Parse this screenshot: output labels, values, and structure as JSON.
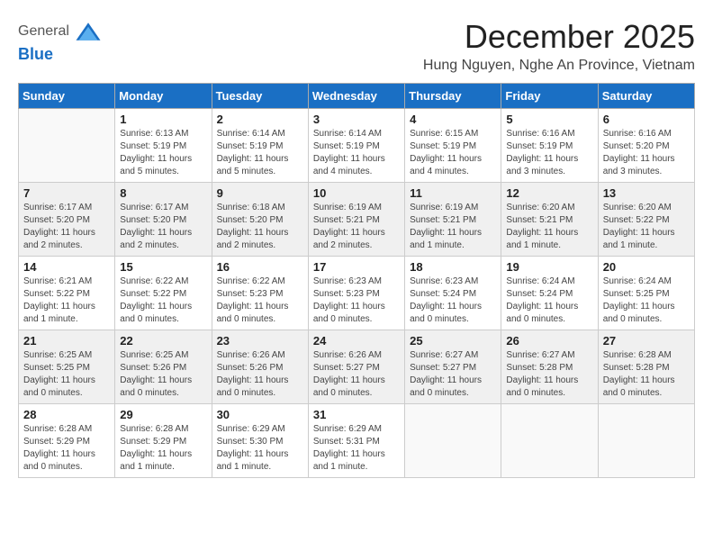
{
  "header": {
    "logo_line1": "General",
    "logo_line2": "Blue",
    "month_year": "December 2025",
    "location": "Hung Nguyen, Nghe An Province, Vietnam"
  },
  "days_of_week": [
    "Sunday",
    "Monday",
    "Tuesday",
    "Wednesday",
    "Thursday",
    "Friday",
    "Saturday"
  ],
  "weeks": [
    [
      {
        "day": "",
        "sunrise": "",
        "sunset": "",
        "daylight": ""
      },
      {
        "day": "1",
        "sunrise": "Sunrise: 6:13 AM",
        "sunset": "Sunset: 5:19 PM",
        "daylight": "Daylight: 11 hours and 5 minutes."
      },
      {
        "day": "2",
        "sunrise": "Sunrise: 6:14 AM",
        "sunset": "Sunset: 5:19 PM",
        "daylight": "Daylight: 11 hours and 5 minutes."
      },
      {
        "day": "3",
        "sunrise": "Sunrise: 6:14 AM",
        "sunset": "Sunset: 5:19 PM",
        "daylight": "Daylight: 11 hours and 4 minutes."
      },
      {
        "day": "4",
        "sunrise": "Sunrise: 6:15 AM",
        "sunset": "Sunset: 5:19 PM",
        "daylight": "Daylight: 11 hours and 4 minutes."
      },
      {
        "day": "5",
        "sunrise": "Sunrise: 6:16 AM",
        "sunset": "Sunset: 5:19 PM",
        "daylight": "Daylight: 11 hours and 3 minutes."
      },
      {
        "day": "6",
        "sunrise": "Sunrise: 6:16 AM",
        "sunset": "Sunset: 5:20 PM",
        "daylight": "Daylight: 11 hours and 3 minutes."
      }
    ],
    [
      {
        "day": "7",
        "sunrise": "Sunrise: 6:17 AM",
        "sunset": "Sunset: 5:20 PM",
        "daylight": "Daylight: 11 hours and 2 minutes."
      },
      {
        "day": "8",
        "sunrise": "Sunrise: 6:17 AM",
        "sunset": "Sunset: 5:20 PM",
        "daylight": "Daylight: 11 hours and 2 minutes."
      },
      {
        "day": "9",
        "sunrise": "Sunrise: 6:18 AM",
        "sunset": "Sunset: 5:20 PM",
        "daylight": "Daylight: 11 hours and 2 minutes."
      },
      {
        "day": "10",
        "sunrise": "Sunrise: 6:19 AM",
        "sunset": "Sunset: 5:21 PM",
        "daylight": "Daylight: 11 hours and 2 minutes."
      },
      {
        "day": "11",
        "sunrise": "Sunrise: 6:19 AM",
        "sunset": "Sunset: 5:21 PM",
        "daylight": "Daylight: 11 hours and 1 minute."
      },
      {
        "day": "12",
        "sunrise": "Sunrise: 6:20 AM",
        "sunset": "Sunset: 5:21 PM",
        "daylight": "Daylight: 11 hours and 1 minute."
      },
      {
        "day": "13",
        "sunrise": "Sunrise: 6:20 AM",
        "sunset": "Sunset: 5:22 PM",
        "daylight": "Daylight: 11 hours and 1 minute."
      }
    ],
    [
      {
        "day": "14",
        "sunrise": "Sunrise: 6:21 AM",
        "sunset": "Sunset: 5:22 PM",
        "daylight": "Daylight: 11 hours and 1 minute."
      },
      {
        "day": "15",
        "sunrise": "Sunrise: 6:22 AM",
        "sunset": "Sunset: 5:22 PM",
        "daylight": "Daylight: 11 hours and 0 minutes."
      },
      {
        "day": "16",
        "sunrise": "Sunrise: 6:22 AM",
        "sunset": "Sunset: 5:23 PM",
        "daylight": "Daylight: 11 hours and 0 minutes."
      },
      {
        "day": "17",
        "sunrise": "Sunrise: 6:23 AM",
        "sunset": "Sunset: 5:23 PM",
        "daylight": "Daylight: 11 hours and 0 minutes."
      },
      {
        "day": "18",
        "sunrise": "Sunrise: 6:23 AM",
        "sunset": "Sunset: 5:24 PM",
        "daylight": "Daylight: 11 hours and 0 minutes."
      },
      {
        "day": "19",
        "sunrise": "Sunrise: 6:24 AM",
        "sunset": "Sunset: 5:24 PM",
        "daylight": "Daylight: 11 hours and 0 minutes."
      },
      {
        "day": "20",
        "sunrise": "Sunrise: 6:24 AM",
        "sunset": "Sunset: 5:25 PM",
        "daylight": "Daylight: 11 hours and 0 minutes."
      }
    ],
    [
      {
        "day": "21",
        "sunrise": "Sunrise: 6:25 AM",
        "sunset": "Sunset: 5:25 PM",
        "daylight": "Daylight: 11 hours and 0 minutes."
      },
      {
        "day": "22",
        "sunrise": "Sunrise: 6:25 AM",
        "sunset": "Sunset: 5:26 PM",
        "daylight": "Daylight: 11 hours and 0 minutes."
      },
      {
        "day": "23",
        "sunrise": "Sunrise: 6:26 AM",
        "sunset": "Sunset: 5:26 PM",
        "daylight": "Daylight: 11 hours and 0 minutes."
      },
      {
        "day": "24",
        "sunrise": "Sunrise: 6:26 AM",
        "sunset": "Sunset: 5:27 PM",
        "daylight": "Daylight: 11 hours and 0 minutes."
      },
      {
        "day": "25",
        "sunrise": "Sunrise: 6:27 AM",
        "sunset": "Sunset: 5:27 PM",
        "daylight": "Daylight: 11 hours and 0 minutes."
      },
      {
        "day": "26",
        "sunrise": "Sunrise: 6:27 AM",
        "sunset": "Sunset: 5:28 PM",
        "daylight": "Daylight: 11 hours and 0 minutes."
      },
      {
        "day": "27",
        "sunrise": "Sunrise: 6:28 AM",
        "sunset": "Sunset: 5:28 PM",
        "daylight": "Daylight: 11 hours and 0 minutes."
      }
    ],
    [
      {
        "day": "28",
        "sunrise": "Sunrise: 6:28 AM",
        "sunset": "Sunset: 5:29 PM",
        "daylight": "Daylight: 11 hours and 0 minutes."
      },
      {
        "day": "29",
        "sunrise": "Sunrise: 6:28 AM",
        "sunset": "Sunset: 5:29 PM",
        "daylight": "Daylight: 11 hours and 1 minute."
      },
      {
        "day": "30",
        "sunrise": "Sunrise: 6:29 AM",
        "sunset": "Sunset: 5:30 PM",
        "daylight": "Daylight: 11 hours and 1 minute."
      },
      {
        "day": "31",
        "sunrise": "Sunrise: 6:29 AM",
        "sunset": "Sunset: 5:31 PM",
        "daylight": "Daylight: 11 hours and 1 minute."
      },
      {
        "day": "",
        "sunrise": "",
        "sunset": "",
        "daylight": ""
      },
      {
        "day": "",
        "sunrise": "",
        "sunset": "",
        "daylight": ""
      },
      {
        "day": "",
        "sunrise": "",
        "sunset": "",
        "daylight": ""
      }
    ]
  ]
}
